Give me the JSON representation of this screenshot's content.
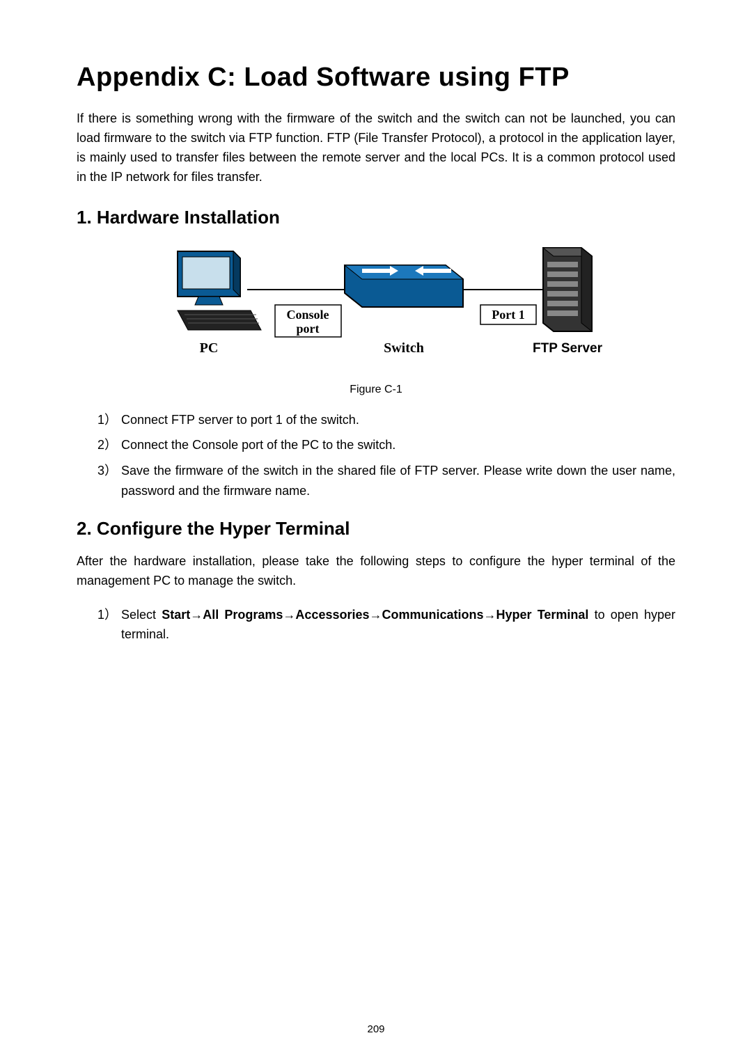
{
  "title": "Appendix C: Load Software using FTP",
  "intro": "If there is something wrong with the firmware of the switch and the switch can not be launched, you can load firmware to the switch via FTP function. FTP (File Transfer Protocol), a protocol in the application layer, is mainly used to transfer files between the remote server and the local PCs. It is a common protocol used in the IP network for files transfer.",
  "section1": {
    "number": "1.",
    "heading": "Hardware Installation",
    "figure_caption": "Figure C-1",
    "labels": {
      "pc": "PC",
      "console_port": "Console port",
      "switch": "Switch",
      "port1": "Port 1",
      "ftp_server": "FTP Server"
    },
    "steps": [
      {
        "marker": "1）",
        "text": "Connect FTP server to port 1 of the switch."
      },
      {
        "marker": "2）",
        "text": "Connect the Console port of the PC to the switch."
      },
      {
        "marker": "3）",
        "text": "Save the firmware of the switch in the shared file of FTP server. Please write down the user name, password and the firmware name."
      }
    ]
  },
  "section2": {
    "number": "2.",
    "heading": "Configure the Hyper Terminal",
    "after": "After the hardware installation, please take the following steps to configure the hyper terminal of the management PC to manage the switch.",
    "steps": [
      {
        "marker": "1）",
        "prefix": "Select  ",
        "bold": "Start→All  Programs→Accessories→Communications→Hyper  Terminal",
        "suffix": "  to open hyper terminal."
      }
    ]
  },
  "page_number": "209"
}
